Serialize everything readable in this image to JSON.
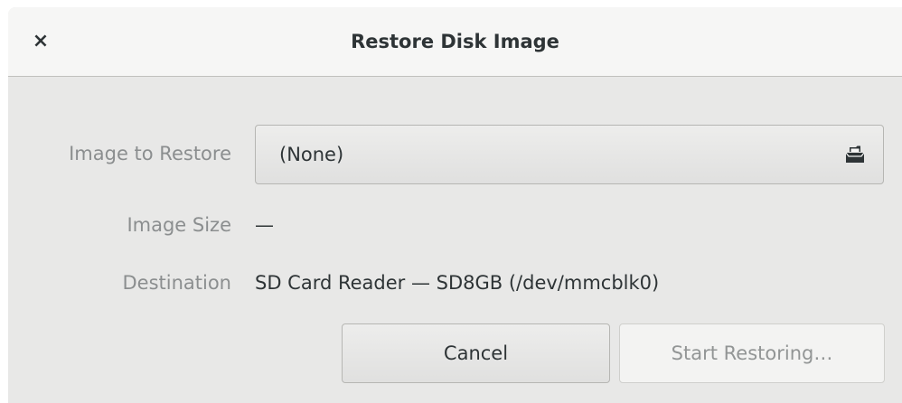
{
  "dialog": {
    "title": "Restore Disk Image",
    "close_symbol": "×"
  },
  "form": {
    "image_label": "Image to Restore",
    "image_value": "(None)",
    "image_icon": "document-open-icon",
    "size_label": "Image Size",
    "size_value": "—",
    "destination_label": "Destination",
    "destination_value": "SD Card Reader — SD8GB (/dev/mmcblk0)"
  },
  "actions": {
    "cancel_label": "Cancel",
    "start_label": "Start Restoring…",
    "start_enabled": false
  },
  "colors": {
    "background": "#e8e8e7",
    "titlebar": "#f6f6f5",
    "label_text": "#8b8e8f",
    "text": "#2e3436",
    "disabled_text": "#929595"
  }
}
